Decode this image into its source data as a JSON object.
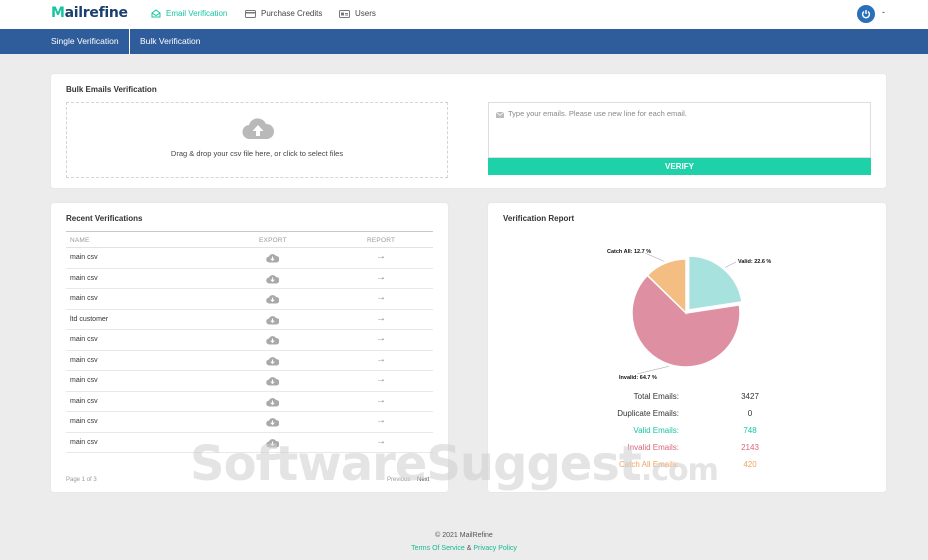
{
  "app": {
    "logo_lead": "M",
    "logo_rest": "ailrefine",
    "user_label": "-"
  },
  "nav": {
    "email_verification": "Email Verification",
    "purchase_credits": "Purchase Credits",
    "users": "Users"
  },
  "subnav": {
    "single": "Single Verification",
    "bulk": "Bulk Verification"
  },
  "bulk": {
    "title": "Bulk Emails Verification",
    "dropzone_text": "Drag & drop your csv file here, or click to select files",
    "emails_placeholder": "Type your emails. Please use new line for each email.",
    "verify_label": "VERIFY"
  },
  "recent": {
    "title": "Recent Verifications",
    "columns": [
      "NAME",
      "EXPORT",
      "REPORT"
    ],
    "rows": [
      {
        "name": "main csv"
      },
      {
        "name": "main csv"
      },
      {
        "name": "main csv"
      },
      {
        "name": "ltd customer"
      },
      {
        "name": "main csv"
      },
      {
        "name": "main csv"
      },
      {
        "name": "main csv"
      },
      {
        "name": "main csv"
      },
      {
        "name": "main csv"
      },
      {
        "name": "main csv"
      }
    ],
    "page_info": "Page 1 of 3",
    "previous": "Previous",
    "next": "Next"
  },
  "report": {
    "title": "Verification Report",
    "stats": [
      {
        "label": "Total Emails:",
        "value": "3427",
        "color": "#333333"
      },
      {
        "label": "Duplicate Emails:",
        "value": "0",
        "color": "#333333"
      },
      {
        "label": "Valid Emails:",
        "value": "748",
        "color": "#16c5a0"
      },
      {
        "label": "Invalid Emails:",
        "value": "2143",
        "color": "#d9667a"
      },
      {
        "label": "Catch All Emails:",
        "value": "420",
        "color": "#f0a35e"
      }
    ]
  },
  "chart_data": {
    "type": "pie",
    "slices": [
      {
        "label": "Valid",
        "display": "Valid: 22.6 %",
        "value": 22.6,
        "color": "#a8e2df"
      },
      {
        "label": "Invalid",
        "display": "Invalid: 64.7 %",
        "value": 64.7,
        "color": "#de90a2"
      },
      {
        "label": "Catch All",
        "display": "Catch All: 12.7 %",
        "value": 12.7,
        "color": "#f4bd82"
      }
    ]
  },
  "footer": {
    "copyright": "© 2021 MailRefine",
    "terms": "Terms Of Service",
    "amp": "&",
    "privacy": "Privacy Policy"
  },
  "watermark": {
    "main": "SoftwareSuggest",
    "suffix": ".com"
  }
}
